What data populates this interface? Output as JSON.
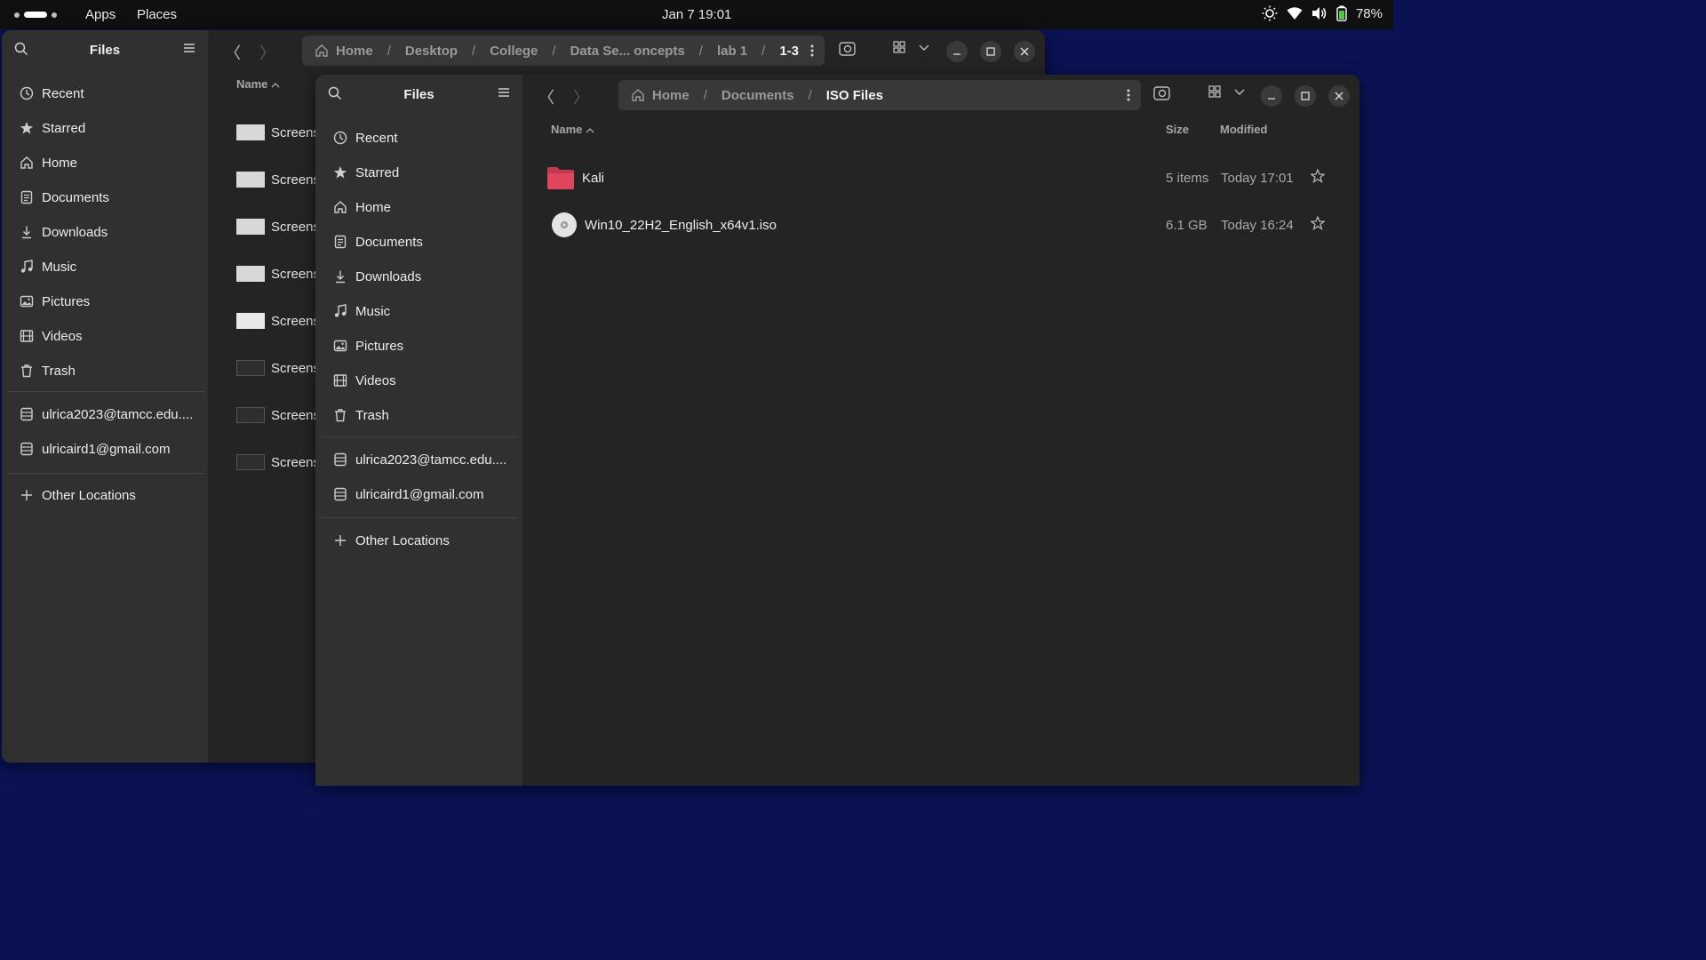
{
  "topbar": {
    "apps_label": "Apps",
    "places_label": "Places",
    "clock": "Jan 7  19:01",
    "battery": "78%"
  },
  "back_window": {
    "sidebar_title": "Files",
    "places": [
      "Recent",
      "Starred",
      "Home",
      "Documents",
      "Downloads",
      "Music",
      "Pictures",
      "Videos",
      "Trash"
    ],
    "accounts": [
      "ulrica2023@tamcc.edu....",
      "ulricaird1@gmail.com"
    ],
    "other_locations": "Other Locations",
    "path": [
      "Home",
      "Desktop",
      "College",
      "Data Se... oncepts",
      "lab 1",
      "1-3"
    ],
    "name_header": "Name",
    "files": [
      "Screens",
      "Screens",
      "Screens",
      "Screens",
      "Screens",
      "Screens",
      "Screens",
      "Screens"
    ]
  },
  "front_window": {
    "sidebar_title": "Files",
    "places": [
      "Recent",
      "Starred",
      "Home",
      "Documents",
      "Downloads",
      "Music",
      "Pictures",
      "Videos",
      "Trash"
    ],
    "accounts": [
      "ulrica2023@tamcc.edu....",
      "ulricaird1@gmail.com"
    ],
    "other_locations": "Other Locations",
    "path": [
      "Home",
      "Documents",
      "ISO Files"
    ],
    "columns": {
      "name": "Name",
      "size": "Size",
      "modified": "Modified"
    },
    "files": [
      {
        "name": "Kali",
        "size": "5 items",
        "modified": "Today 17:01",
        "icon": "folder-icon"
      },
      {
        "name": "Win10_22H2_English_x64v1.iso",
        "size": "6.1 GB",
        "modified": "Today 16:24",
        "icon": "disc-image-icon"
      }
    ]
  },
  "colors": {
    "desktop": "#0a1254",
    "window_bg": "#242424",
    "sidebar_bg": "#303030",
    "folder": "#e0475e"
  }
}
